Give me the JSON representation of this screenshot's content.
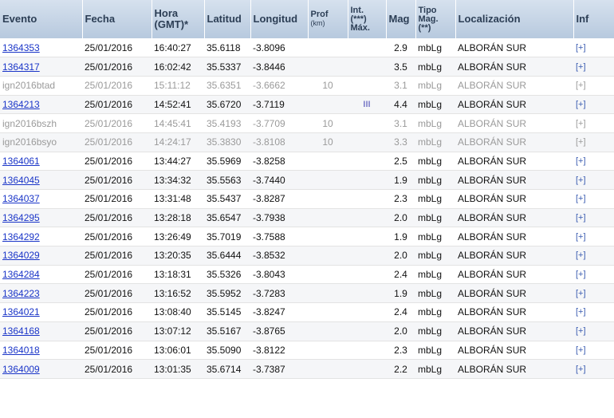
{
  "headers": {
    "evento": "Evento",
    "fecha": "Fecha",
    "hora_1": "Hora",
    "hora_2": "(GMT)*",
    "latitud": "Latitud",
    "longitud": "Longitud",
    "prof_1": "Prof",
    "prof_2": "(km)",
    "int_1": "Int.",
    "int_2": "(***)",
    "int_3": "Máx.",
    "mag": "Mag",
    "tipo_1": "Tipo",
    "tipo_2": "Mag.",
    "tipo_3": "(**)",
    "localizacion": "Localización",
    "inf": "Inf"
  },
  "rows": [
    {
      "evento": "1364353",
      "link": true,
      "fecha": "25/01/2016",
      "hora": "16:40:27",
      "lat": "35.6118",
      "lon": "-3.8096",
      "prof": "",
      "int": "",
      "mag": "2.9",
      "tipo": "mbLg",
      "loc": "ALBORÁN SUR",
      "inf": "[+]",
      "preliminary": false
    },
    {
      "evento": "1364317",
      "link": true,
      "fecha": "25/01/2016",
      "hora": "16:02:42",
      "lat": "35.5337",
      "lon": "-3.8446",
      "prof": "",
      "int": "",
      "mag": "3.5",
      "tipo": "mbLg",
      "loc": "ALBORÁN SUR",
      "inf": "[+]",
      "preliminary": false
    },
    {
      "evento": "ign2016btad",
      "link": false,
      "fecha": "25/01/2016",
      "hora": "15:11:12",
      "lat": "35.6351",
      "lon": "-3.6662",
      "prof": "10",
      "int": "",
      "mag": "3.1",
      "tipo": "mbLg",
      "loc": "ALBORÁN SUR",
      "inf": "[+]",
      "preliminary": true
    },
    {
      "evento": "1364213",
      "link": true,
      "fecha": "25/01/2016",
      "hora": "14:52:41",
      "lat": "35.6720",
      "lon": "-3.7119",
      "prof": "",
      "int": "III",
      "mag": "4.4",
      "tipo": "mbLg",
      "loc": "ALBORÁN SUR",
      "inf": "[+]",
      "preliminary": false
    },
    {
      "evento": "ign2016bszh",
      "link": false,
      "fecha": "25/01/2016",
      "hora": "14:45:41",
      "lat": "35.4193",
      "lon": "-3.7709",
      "prof": "10",
      "int": "",
      "mag": "3.1",
      "tipo": "mbLg",
      "loc": "ALBORÁN SUR",
      "inf": "[+]",
      "preliminary": true
    },
    {
      "evento": "ign2016bsyo",
      "link": false,
      "fecha": "25/01/2016",
      "hora": "14:24:17",
      "lat": "35.3830",
      "lon": "-3.8108",
      "prof": "10",
      "int": "",
      "mag": "3.3",
      "tipo": "mbLg",
      "loc": "ALBORÁN SUR",
      "inf": "[+]",
      "preliminary": true
    },
    {
      "evento": "1364061",
      "link": true,
      "fecha": "25/01/2016",
      "hora": "13:44:27",
      "lat": "35.5969",
      "lon": "-3.8258",
      "prof": "",
      "int": "",
      "mag": "2.5",
      "tipo": "mbLg",
      "loc": "ALBORÁN SUR",
      "inf": "[+]",
      "preliminary": false
    },
    {
      "evento": "1364045",
      "link": true,
      "fecha": "25/01/2016",
      "hora": "13:34:32",
      "lat": "35.5563",
      "lon": "-3.7440",
      "prof": "",
      "int": "",
      "mag": "1.9",
      "tipo": "mbLg",
      "loc": "ALBORÁN SUR",
      "inf": "[+]",
      "preliminary": false
    },
    {
      "evento": "1364037",
      "link": true,
      "fecha": "25/01/2016",
      "hora": "13:31:48",
      "lat": "35.5437",
      "lon": "-3.8287",
      "prof": "",
      "int": "",
      "mag": "2.3",
      "tipo": "mbLg",
      "loc": "ALBORÁN SUR",
      "inf": "[+]",
      "preliminary": false
    },
    {
      "evento": "1364295",
      "link": true,
      "fecha": "25/01/2016",
      "hora": "13:28:18",
      "lat": "35.6547",
      "lon": "-3.7938",
      "prof": "",
      "int": "",
      "mag": "2.0",
      "tipo": "mbLg",
      "loc": "ALBORÁN SUR",
      "inf": "[+]",
      "preliminary": false
    },
    {
      "evento": "1364292",
      "link": true,
      "fecha": "25/01/2016",
      "hora": "13:26:49",
      "lat": "35.7019",
      "lon": "-3.7588",
      "prof": "",
      "int": "",
      "mag": "1.9",
      "tipo": "mbLg",
      "loc": "ALBORÁN SUR",
      "inf": "[+]",
      "preliminary": false
    },
    {
      "evento": "1364029",
      "link": true,
      "fecha": "25/01/2016",
      "hora": "13:20:35",
      "lat": "35.6444",
      "lon": "-3.8532",
      "prof": "",
      "int": "",
      "mag": "2.0",
      "tipo": "mbLg",
      "loc": "ALBORÁN SUR",
      "inf": "[+]",
      "preliminary": false
    },
    {
      "evento": "1364284",
      "link": true,
      "fecha": "25/01/2016",
      "hora": "13:18:31",
      "lat": "35.5326",
      "lon": "-3.8043",
      "prof": "",
      "int": "",
      "mag": "2.4",
      "tipo": "mbLg",
      "loc": "ALBORÁN SUR",
      "inf": "[+]",
      "preliminary": false
    },
    {
      "evento": "1364223",
      "link": true,
      "fecha": "25/01/2016",
      "hora": "13:16:52",
      "lat": "35.5952",
      "lon": "-3.7283",
      "prof": "",
      "int": "",
      "mag": "1.9",
      "tipo": "mbLg",
      "loc": "ALBORÁN SUR",
      "inf": "[+]",
      "preliminary": false
    },
    {
      "evento": "1364021",
      "link": true,
      "fecha": "25/01/2016",
      "hora": "13:08:40",
      "lat": "35.5145",
      "lon": "-3.8247",
      "prof": "",
      "int": "",
      "mag": "2.4",
      "tipo": "mbLg",
      "loc": "ALBORÁN SUR",
      "inf": "[+]",
      "preliminary": false
    },
    {
      "evento": "1364168",
      "link": true,
      "fecha": "25/01/2016",
      "hora": "13:07:12",
      "lat": "35.5167",
      "lon": "-3.8765",
      "prof": "",
      "int": "",
      "mag": "2.0",
      "tipo": "mbLg",
      "loc": "ALBORÁN SUR",
      "inf": "[+]",
      "preliminary": false
    },
    {
      "evento": "1364018",
      "link": true,
      "fecha": "25/01/2016",
      "hora": "13:06:01",
      "lat": "35.5090",
      "lon": "-3.8122",
      "prof": "",
      "int": "",
      "mag": "2.3",
      "tipo": "mbLg",
      "loc": "ALBORÁN SUR",
      "inf": "[+]",
      "preliminary": false
    },
    {
      "evento": "1364009",
      "link": true,
      "fecha": "25/01/2016",
      "hora": "13:01:35",
      "lat": "35.6714",
      "lon": "-3.7387",
      "prof": "",
      "int": "",
      "mag": "2.2",
      "tipo": "mbLg",
      "loc": "ALBORÁN SUR",
      "inf": "[+]",
      "preliminary": false
    }
  ]
}
